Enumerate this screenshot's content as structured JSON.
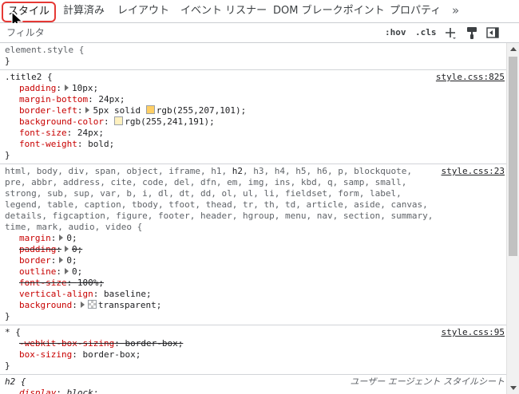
{
  "tabs": {
    "items": [
      {
        "label": "スタイル",
        "active": true
      },
      {
        "label": "計算済み"
      },
      {
        "label": "レイアウト"
      },
      {
        "label": "イベント リスナー"
      },
      {
        "label": "DOM ブレークポイント"
      },
      {
        "label": "プロパティ"
      }
    ],
    "more": "»"
  },
  "filter": {
    "placeholder": "フィルタ",
    "hov": ":hov",
    "cls": ".cls",
    "icons": [
      "plus-icon",
      "paint-brush-icon",
      "toggle-sidebar-icon"
    ]
  },
  "rules": {
    "element_style": {
      "selector": "element.style {",
      "close": "}"
    },
    "title2": {
      "selector": ".title2 {",
      "source": "style.css:825",
      "decls": [
        {
          "prop": "padding",
          "value": "10px;"
        },
        {
          "prop": "margin-bottom",
          "value": "24px;"
        },
        {
          "prop": "border-left",
          "value_pre": "5px solid ",
          "color_text": "rgb(255,207,101);",
          "swatch": "#ffcf65"
        },
        {
          "prop": "background-color",
          "color_text": "rgb(255,241,191);",
          "swatch": "#fff1bf"
        },
        {
          "prop": "font-size",
          "value": "24px;"
        },
        {
          "prop": "font-weight",
          "value": "bold;"
        }
      ],
      "close": "}"
    },
    "reset": {
      "selector_before": "html, body, div, span, object, iframe, h1, ",
      "selector_match": "h2",
      "selector_after": ", h3, h4, h5, h6, p, blockquote, pre, abbr, address, cite, code, del, dfn, em, img, ins, kbd, q, samp, small, strong, sub, sup, var, b, i, dl, dt, dd, ol, ul, li, fieldset, form, label, legend, table, caption, tbody, tfoot, thead, tr, th, td, article, aside, canvas, details, figcaption, figure, footer, header, hgroup, menu, nav, section, summary, time, mark, audio, video {",
      "source": "style.css:23",
      "decls": [
        {
          "prop": "margin",
          "value": "0;"
        },
        {
          "prop": "padding",
          "value": "0;"
        },
        {
          "prop": "border",
          "value": "0;"
        },
        {
          "prop": "outline",
          "value": "0;"
        },
        {
          "prop": "font-size",
          "value": "100%;"
        },
        {
          "prop": "vertical-align",
          "value": "baseline;"
        },
        {
          "prop": "background",
          "value": "transparent;"
        }
      ],
      "close": "}"
    },
    "universal": {
      "selector": "* {",
      "source": "style.css:95",
      "decls": [
        {
          "prop": "-webkit-box-sizing",
          "value": "border-box;"
        },
        {
          "prop": "box-sizing",
          "value": "border-box;"
        }
      ],
      "close": "}"
    },
    "ua_h2": {
      "selector": "h2 {",
      "source": "ユーザー エージェント スタイルシート",
      "decls": [
        {
          "prop": "display",
          "value": "block;"
        }
      ]
    }
  },
  "colors": {
    "active_tab_outline": "#e53935",
    "property": "#c80000"
  }
}
